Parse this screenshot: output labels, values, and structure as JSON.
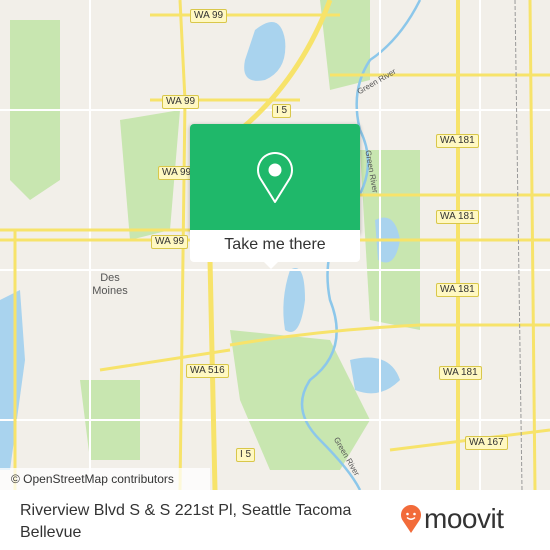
{
  "map": {
    "attribution": "© OpenStreetMap contributors",
    "places": [
      {
        "name": "Des Moines"
      }
    ],
    "river_labels": [
      "Green River",
      "Green River",
      "Green River"
    ],
    "shields": [
      {
        "label": "WA 99"
      },
      {
        "label": "WA 99"
      },
      {
        "label": "WA 99"
      },
      {
        "label": "WA 99"
      },
      {
        "label": "I 5"
      },
      {
        "label": "I 5"
      },
      {
        "label": "WA 181"
      },
      {
        "label": "WA 181"
      },
      {
        "label": "WA 181"
      },
      {
        "label": "WA 181"
      },
      {
        "label": "WA 516"
      },
      {
        "label": "WA 167"
      }
    ],
    "colors": {
      "land": "#f2efe9",
      "park": "#c8e6b0",
      "water": "#a9d3ee",
      "road": "#f7e36a"
    }
  },
  "popup": {
    "icon": "map-pin-icon",
    "button_label": "Take me there",
    "color": "#1fb86a"
  },
  "footer": {
    "address": "Riverview Blvd S & S 221st Pl, Seattle Tacoma Bellevue",
    "logo": "moovit",
    "logo_color": "#f26b3a"
  }
}
